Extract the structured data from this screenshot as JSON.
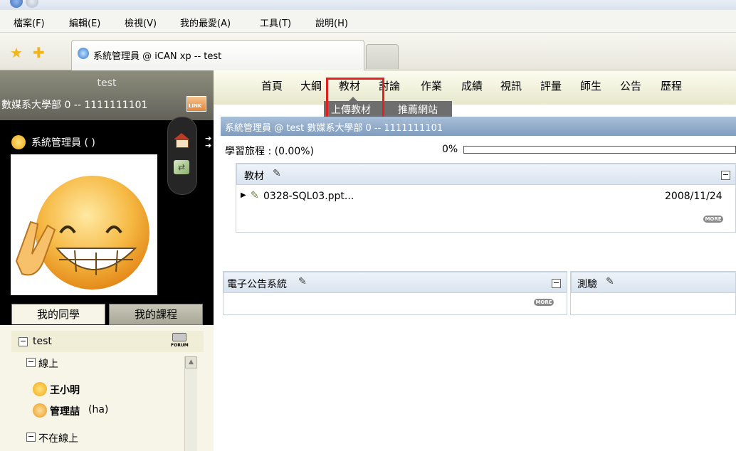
{
  "menubar": {
    "items": [
      "檔案(F)",
      "編輯(E)",
      "檢視(V)",
      "我的最愛(A)",
      "工具(T)",
      "說明(H)"
    ]
  },
  "browser": {
    "tab_title": "系統管理員 @ iCAN xp -- test"
  },
  "left": {
    "course_name": "test",
    "dept_line": "數媒系大學部 0 -- 1111111101",
    "link_badge": "LINK",
    "user_label": "系統管理員 ( )",
    "tabs": [
      "我的同學",
      "我的課程"
    ],
    "group_name": "test",
    "forum_badge": "FORUM",
    "online_label": "線上",
    "offline_label": "不在線上",
    "buddies": [
      {
        "name": "王小明",
        "extra": ""
      },
      {
        "name": "管理喆",
        "extra": "(ha)"
      }
    ]
  },
  "nav": {
    "items": [
      "首頁",
      "大綱",
      "教材",
      "討論",
      "作業",
      "成績",
      "視訊",
      "評量",
      "師生",
      "公告",
      "歷程"
    ],
    "sub_items": [
      "上傳教材",
      "推薦網站"
    ]
  },
  "content": {
    "strip_text": "系統管理員 @ test  數媒系大學部 0 -- 1111111101",
    "progress_label": "學習旅程 : (0.00%)",
    "progress_pct": "0%",
    "progress_value": 0,
    "materials_title": "教材",
    "material_file": "0328-SQL03.ppt...",
    "material_date": "2008/11/24",
    "more_label": "MORE",
    "bulletin_title": "電子公告系統",
    "quiz_title": "測驗"
  },
  "colors": {
    "highlight_box": "#e32020",
    "nav_bg": "#eeefd6",
    "strip_bg": "#8fa9c9"
  }
}
